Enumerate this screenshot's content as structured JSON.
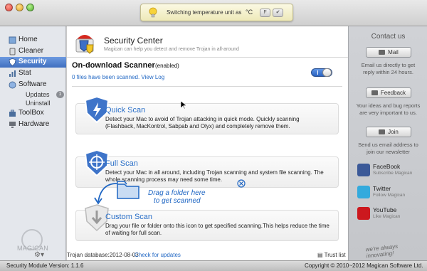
{
  "notification": {
    "text": "Switching temperature unit as",
    "unit": "°C",
    "btn_f": "F",
    "btn_ok": "✔"
  },
  "sidebar": {
    "items": [
      {
        "label": "Home",
        "icon": "home-icon"
      },
      {
        "label": "Cleaner",
        "icon": "cleaner-icon"
      },
      {
        "label": "Security",
        "icon": "security-icon",
        "active": true
      },
      {
        "label": "Stat",
        "icon": "stat-icon"
      },
      {
        "label": "Software",
        "icon": "software-icon"
      },
      {
        "label": "ToolBox",
        "icon": "toolbox-icon"
      },
      {
        "label": "Hardware",
        "icon": "hardware-icon"
      }
    ],
    "subitems": {
      "updates": "Updates",
      "uninstall": "Uninstall"
    },
    "updates_badge": "1",
    "brand": "MAGICAN"
  },
  "header": {
    "title": "Security Center",
    "subtitle": "Magican can help you detect and remove Trojan in all-around"
  },
  "ods": {
    "title": "On-download Scanner",
    "status": "(enabled)",
    "count_text": "0 files have been scanned.",
    "view_log": "View Log",
    "toggle_on": true
  },
  "cards": {
    "quick": {
      "title": "Quick Scan",
      "desc": "Detect your Mac to avoid of Trojan attacking in quick mode. Quickly scanning (Flashback, MacKontrol, Sabpab and Olyx) and completely remove them."
    },
    "full": {
      "title": "Full Scan",
      "desc": "Detect your Mac in all around, including Trojan scanning and system file scanning. The whole scanning process may need some time."
    },
    "custom": {
      "title": "Custom Scan",
      "desc": "Drag your file or folder onto this icon to get specified scanning.This helps reduce the time of waiting for full scan."
    }
  },
  "drag_hint": {
    "line1": "Drag a folder here",
    "line2": "to get scanned"
  },
  "footer": {
    "database": "Trojan database:2012-08-03",
    "check_updates": "Check for updates",
    "trust_list": "Trust list"
  },
  "contact": {
    "title": "Contact us",
    "mail": {
      "label": "Mail",
      "desc": "Email us directly to get reply within 24 hours."
    },
    "feedback": {
      "label": "Feedback",
      "desc": "Your ideas and bug reports are very important to us."
    },
    "join": {
      "label": "Join",
      "desc": "Send us email address to join our newsletter"
    },
    "socials": [
      {
        "name": "FaceBook",
        "sub": "Subscribe Magican",
        "color": "#3b5998"
      },
      {
        "name": "Twitter",
        "sub": "Follow Magican",
        "color": "#33aadd"
      },
      {
        "name": "YouTube",
        "sub": "Like Magican",
        "color": "#cc181e"
      }
    ]
  },
  "tagline": "we're always innovating!",
  "status": {
    "version": "Security Module Version: 1.1.6",
    "copyright": "Copyright © 2010~2012 Magican Software Ltd."
  }
}
